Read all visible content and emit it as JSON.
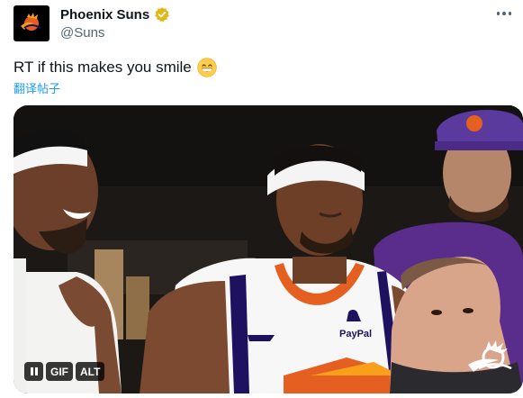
{
  "tweet": {
    "display_name": "Phoenix Suns",
    "handle": "@Suns",
    "text": "RT if this makes you smile",
    "emoji_icon": "grinning-face-emoji",
    "translate_label": "翻译帖子",
    "verified_icon": "gold-verified-badge-icon",
    "more_icon": "more-options-icon"
  },
  "media": {
    "type": "GIF",
    "pause_icon": "pause-icon",
    "gif_label": "GIF",
    "alt_label": "ALT",
    "watermark_icon": "suns-logo-icon",
    "jersey_sponsor": "PayPal"
  },
  "colors": {
    "text": "#0f1419",
    "secondary": "#536471",
    "link": "#1d9bf0",
    "verified": "#e2b719",
    "suns_orange": "#e56020",
    "suns_purple": "#1d1160"
  }
}
